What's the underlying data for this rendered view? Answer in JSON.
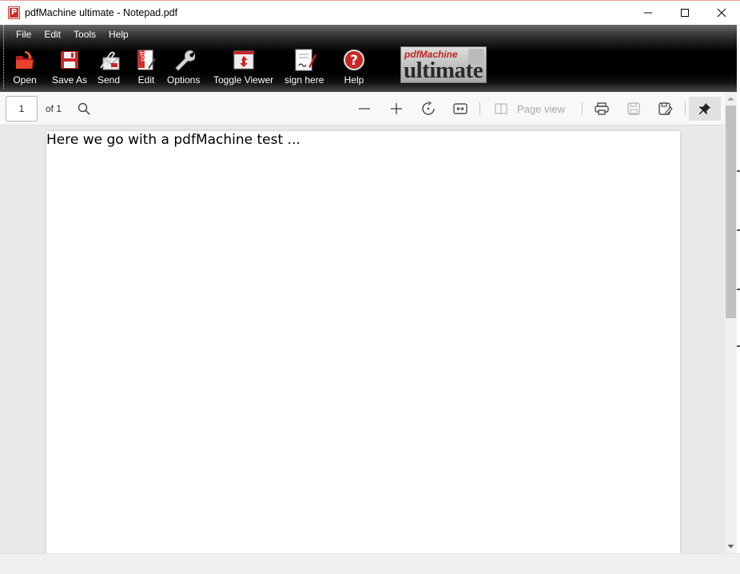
{
  "window": {
    "title": "pdfMachine ultimate - Notepad.pdf",
    "app_icon_letter": "P"
  },
  "menu": [
    "File",
    "Edit",
    "Tools",
    "Help"
  ],
  "toolbar": {
    "open": "Open",
    "save_as": "Save As",
    "send": "Send",
    "edit": "Edit",
    "options": "Options",
    "toggle_viewer": "Toggle Viewer",
    "sign_here": "sign here",
    "help": "Help"
  },
  "logo": {
    "line1": "pdfMachine",
    "line2": "ultimate"
  },
  "viewer": {
    "page_number": "1",
    "page_of": "of 1",
    "page_view_label": "Page view"
  },
  "document": {
    "text": "Here we go with a pdfMachine test ..."
  },
  "colors": {
    "accent_red": "#d42b2b",
    "toolbar_black": "#000000"
  }
}
